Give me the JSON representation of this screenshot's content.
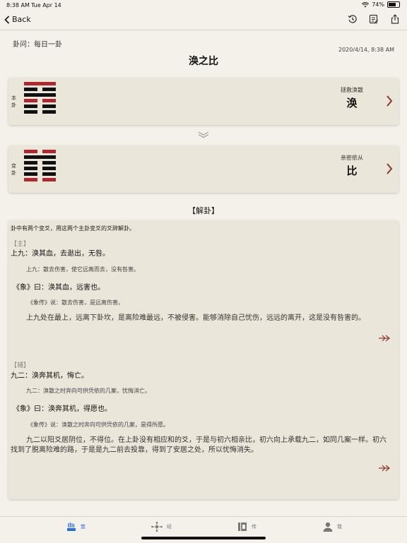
{
  "status": {
    "time": "8:38 AM",
    "date": "Tue Apr 14",
    "battery": "74%",
    "battery_level": 0.74
  },
  "nav": {
    "back_label": "Back"
  },
  "reading": {
    "question": "卦问：每日一卦",
    "timestamp": "2020/4/14, 8:38 AM",
    "title": "涣之比"
  },
  "primary": {
    "side_label": [
      "本",
      "卦"
    ],
    "desc": "拯救涣散",
    "name": "涣",
    "lines": [
      "yang",
      "yin",
      "yang",
      "yin",
      "yin",
      "yin"
    ],
    "changing": [
      0,
      3
    ]
  },
  "changed": {
    "side_label": [
      "变",
      "卦"
    ],
    "desc": "亲密依从",
    "name": "比",
    "lines": [
      "yin",
      "yang",
      "yin",
      "yin",
      "yin",
      "yin"
    ],
    "changing": [
      0,
      5
    ]
  },
  "colors": {
    "yang_line": "#111111",
    "changing_line": "#b3262e",
    "chevron": "#8a3a2a",
    "tab_active": "#2a6fd6"
  },
  "interpretation": {
    "section_title": "【解卦】",
    "intro": "卦中有两个变爻，用这两个主卦变爻的爻辞解卦。",
    "main": {
      "tag": "【主】",
      "line_text": "上九：涣其血，去逖出，无咎。",
      "line_note": "上九：散去伤害，使它远离而去，没有咎害。",
      "image_text": "《象》曰：涣其血，远害也。",
      "image_note": "《象传》说：散去伤害，是远离伤害。",
      "explanation": "上九处在最上，远离下卦坎，是离险难最远，不被侵害。能够消除自己忧伤，远远的离开，这是没有咎害的。"
    },
    "aux": {
      "tag": "【辅】",
      "line_text": "九二：涣奔其机，悔亡。",
      "line_note": "九二：涣散之时奔向可供凭依的几案，忧悔消亡。",
      "image_text": "《象》曰：涣奔其机，得愿也。",
      "image_note": "《象传》说：涣散之时奔向可供凭依的几案，是得所愿。",
      "explanation": "九二以阳爻居阴位，不得位。在上卦没有相应和的爻，于是与初六相亲比，初六向上承载九二，如同几案一样。初六找到了脱离险难的路，于是是九二前去投靠，得到了安居之处，所以忧悔消失。"
    }
  },
  "tabs": [
    {
      "label": "筮",
      "icon": "yarrow-icon",
      "active": true
    },
    {
      "label": "经",
      "icon": "network-icon",
      "active": false
    },
    {
      "label": "传",
      "icon": "book-icon",
      "active": false
    },
    {
      "label": "我",
      "icon": "person-icon",
      "active": false
    }
  ]
}
